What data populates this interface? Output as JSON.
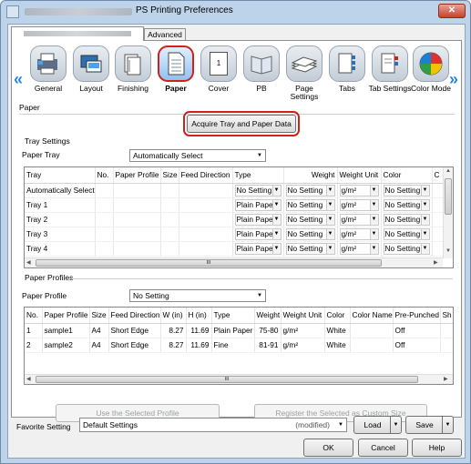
{
  "window": {
    "title": "PS Printing Preferences",
    "close_label": "✕"
  },
  "tabs": [
    {
      "label": ""
    },
    {
      "label": "Advanced"
    }
  ],
  "toolbar": {
    "items": [
      {
        "label": "General",
        "icon": "general-icon"
      },
      {
        "label": "Layout",
        "icon": "layout-icon"
      },
      {
        "label": "Finishing",
        "icon": "finishing-icon"
      },
      {
        "label": "Paper",
        "icon": "paper-icon"
      },
      {
        "label": "Cover",
        "icon": "cover-icon"
      },
      {
        "label": "PB",
        "icon": "pb-icon"
      },
      {
        "label": "Page Settings",
        "icon": "page-settings-icon"
      },
      {
        "label": "Tabs",
        "icon": "tabs-icon"
      },
      {
        "label": "Tab Settings",
        "icon": "tab-settings-icon"
      },
      {
        "label": "Color Mode",
        "icon": "color-mode-icon"
      }
    ],
    "cover_glyph": "1",
    "scroll_left": "«",
    "scroll_right": "»"
  },
  "paper": {
    "group_label": "Paper",
    "acquire_button": "Acquire Tray and Paper Data",
    "tray_settings_label": "Tray Settings",
    "paper_tray_label": "Paper Tray",
    "paper_tray_value": "Automatically Select",
    "tray_columns": [
      "Tray",
      "No.",
      "Paper Profile",
      "Size",
      "Feed Direction",
      "Type",
      "Weight",
      "Weight Unit",
      "Color",
      "C"
    ],
    "tray_rows": [
      {
        "tray": "Automatically Select",
        "type": "No Setting",
        "weight": "No Setting",
        "unit": "g/m²",
        "color": "No Setting"
      },
      {
        "tray": "Tray 1",
        "type": "Plain Paper",
        "weight": "No Setting",
        "unit": "g/m²",
        "color": "No Setting"
      },
      {
        "tray": "Tray 2",
        "type": "Plain Paper",
        "weight": "No Setting",
        "unit": "g/m²",
        "color": "No Setting"
      },
      {
        "tray": "Tray 3",
        "type": "Plain Paper",
        "weight": "No Setting",
        "unit": "g/m²",
        "color": "No Setting"
      },
      {
        "tray": "Tray 4",
        "type": "Plain Paper",
        "weight": "No Setting",
        "unit": "g/m²",
        "color": "No Setting"
      }
    ],
    "scroll_thumb": "III"
  },
  "profiles": {
    "group_label": "Paper Profiles",
    "paper_profile_label": "Paper Profile",
    "paper_profile_value": "No Setting",
    "columns": [
      "No.",
      "Paper Profile",
      "Size",
      "Feed Direction",
      "W (in)",
      "H (in)",
      "Type",
      "Weight",
      "Weight Unit",
      "Color",
      "Color Name",
      "Pre-Punched",
      "Sh"
    ],
    "rows": [
      {
        "no": "1",
        "profile": "sample1",
        "size": "A4",
        "feed": "Short Edge",
        "w": "8.27",
        "h": "11.69",
        "type": "Plain Paper",
        "weight": "75-80",
        "unit": "g/m²",
        "color": "White",
        "color_name": "",
        "punched": "Off"
      },
      {
        "no": "2",
        "profile": "sample2",
        "size": "A4",
        "feed": "Short Edge",
        "w": "8.27",
        "h": "11.69",
        "type": "Fine",
        "weight": "81-91",
        "unit": "g/m²",
        "color": "White",
        "color_name": "",
        "punched": "Off"
      }
    ],
    "scroll_thumb": "III",
    "use_button": "Use the Selected Profile",
    "register_button": "Register the Selected as Custom Size"
  },
  "favorite": {
    "label": "Favorite Setting",
    "value": "Default Settings",
    "modified": "(modified)",
    "load_button": "Load",
    "save_button": "Save"
  },
  "dialog": {
    "ok": "OK",
    "cancel": "Cancel",
    "help": "Help"
  },
  "colors": {
    "highlight": "#d0201a",
    "title_bg": "#bcd3ea",
    "close_red": "#c7402c",
    "accent_arrow": "#2a87d8"
  }
}
